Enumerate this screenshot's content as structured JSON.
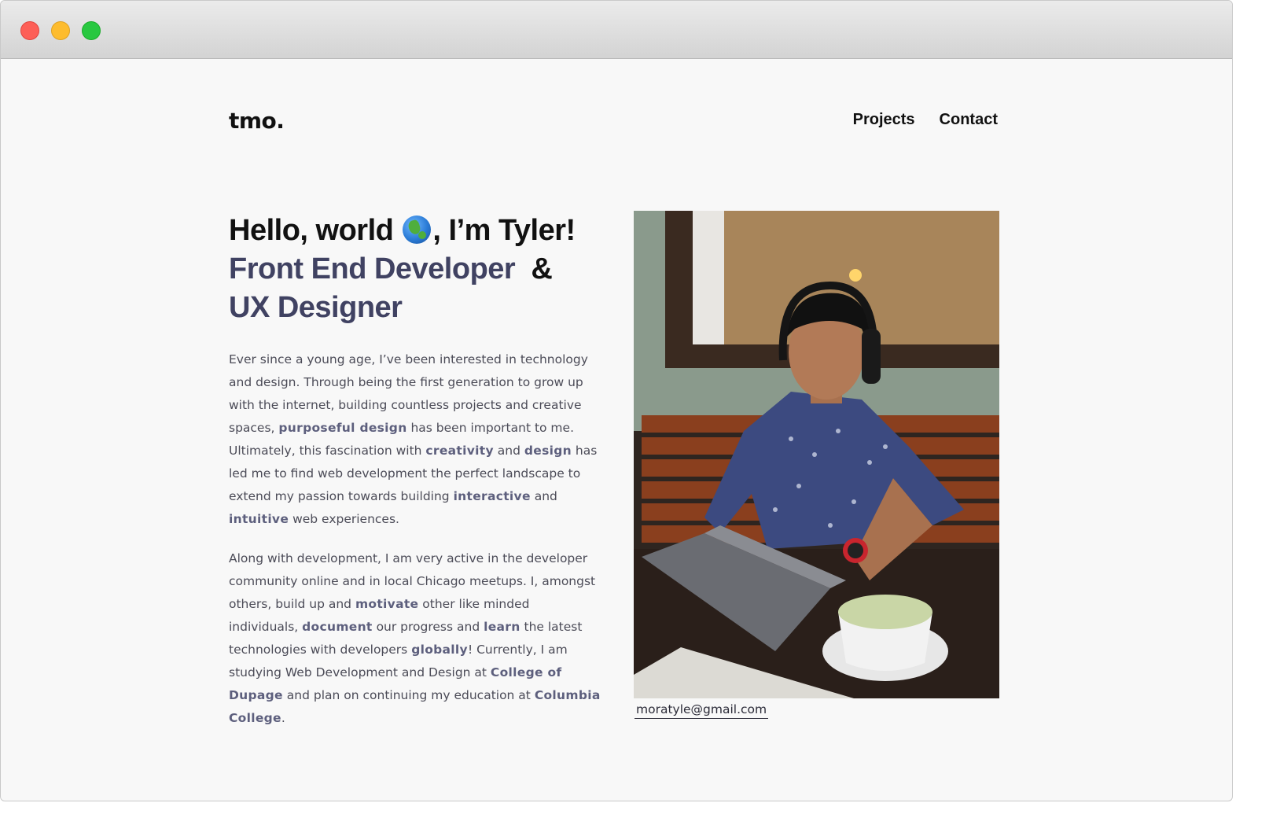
{
  "header": {
    "logo": "tmo.",
    "nav": {
      "projects": "Projects",
      "contact": "Contact"
    }
  },
  "hero": {
    "line1a": "Hello, world",
    "line1b": ", I’m Tyler!",
    "role1": "Front End Developer",
    "amp": "&",
    "role2": "UX Designer"
  },
  "about": {
    "p1": {
      "t1": "Ever since a young age, I’ve been interested in technology and design. Through being the first generation to grow up with the internet, building countless projects and creative spaces, ",
      "b1": "purposeful design",
      "t2": " has been important to me. Ultimately, this fascination with ",
      "b2": "creativity",
      "t3": " and ",
      "b3": "design",
      "t4": " has led me to find web development the perfect landscape to extend my passion towards building ",
      "b4": "interactive",
      "t5": " and ",
      "b5": "intuitive",
      "t6": " web experiences."
    },
    "p2": {
      "t1": "Along with development, I am very active in the developer community online and in local Chicago meetups. I, amongst others, build up and ",
      "b1": "motivate",
      "t2": " other like minded individuals, ",
      "b2": "document",
      "t3": " our progress and ",
      "b3": "learn",
      "t4": " the latest technologies with developers ",
      "b4": "globally",
      "t5": "! Currently, I am studying Web Development and Design at ",
      "b5": "College of Dupage",
      "t6": " and plan on continuing my education at ",
      "b6": "Columbia College",
      "t7": "."
    }
  },
  "contact": {
    "email": "moratyle@gmail.com"
  },
  "icons": {
    "globe": "globe-emoji-icon"
  },
  "colors": {
    "accent": "#404262",
    "text": "#4b4b57",
    "background": "#f8f8f8"
  }
}
